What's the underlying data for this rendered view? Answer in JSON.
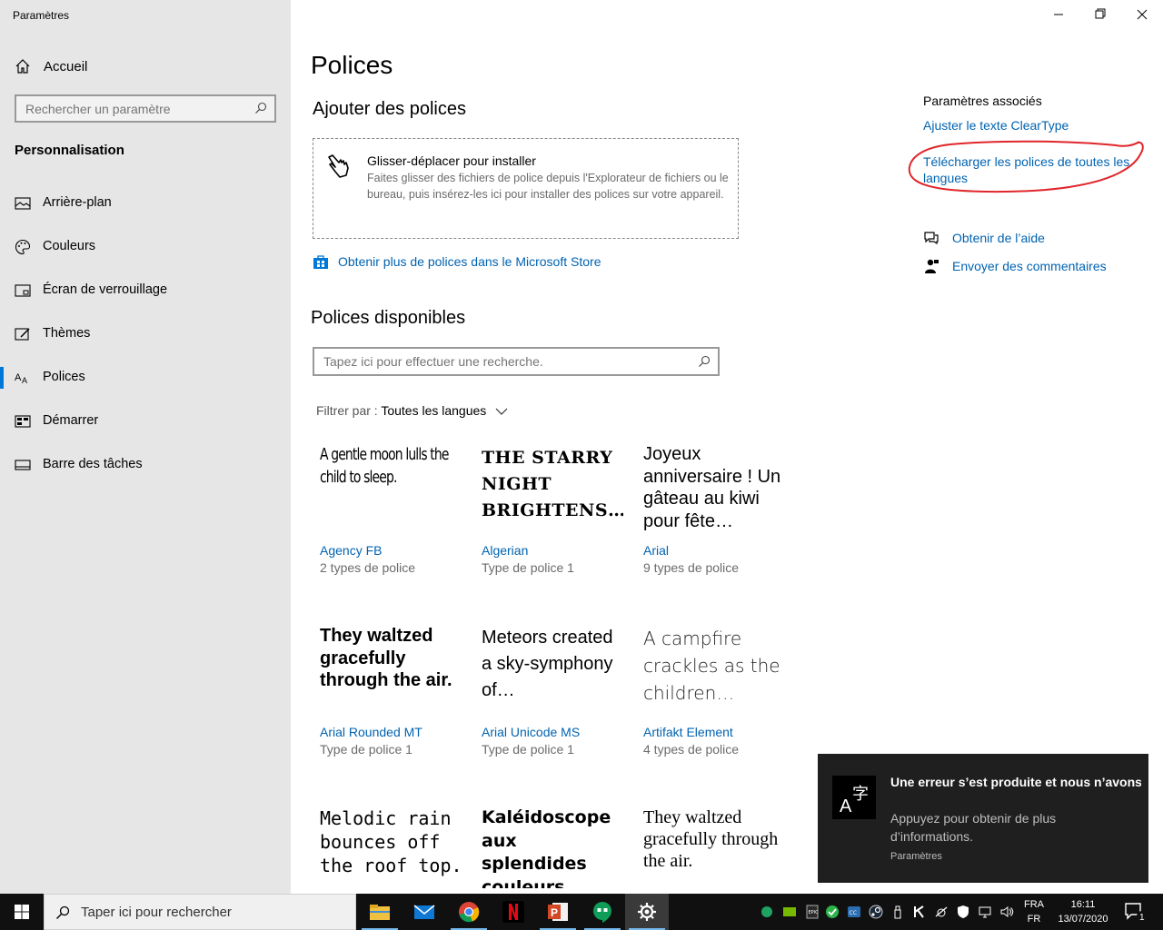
{
  "window": {
    "title": "Paramètres",
    "minimize_icon": "minimize-icon",
    "restore_icon": "restore-icon",
    "close_icon": "close-icon"
  },
  "sidebar": {
    "home_label": "Accueil",
    "search_placeholder": "Rechercher un paramètre",
    "section": "Personnalisation",
    "items": [
      {
        "label": "Arrière-plan",
        "icon": "picture-icon"
      },
      {
        "label": "Couleurs",
        "icon": "palette-icon"
      },
      {
        "label": "Écran de verrouillage",
        "icon": "lockscreen-icon"
      },
      {
        "label": "Thèmes",
        "icon": "brush-icon"
      },
      {
        "label": "Polices",
        "icon": "font-icon",
        "active": true
      },
      {
        "label": "Démarrer",
        "icon": "start-icon"
      },
      {
        "label": "Barre des tâches",
        "icon": "taskbar-icon"
      }
    ]
  },
  "main": {
    "title": "Polices",
    "add_heading": "Ajouter des polices",
    "dropzone_title": "Glisser-déplacer pour installer",
    "dropzone_desc": "Faites glisser des fichiers de police depuis l'Explorateur de fichiers ou le bureau, puis insérez-les ici pour installer des polices sur votre appareil.",
    "store_link": "Obtenir plus de polices dans le Microsoft Store",
    "available_heading": "Polices disponibles",
    "search_placeholder": "Tapez ici pour effectuer une recherche.",
    "filter_label": "Filtrer par :",
    "filter_value": "Toutes les langues"
  },
  "fonts": [
    {
      "sample": "A gentle moon lulls the child to sleep.",
      "name": "Agency FB",
      "count": "2 types de police"
    },
    {
      "sample": "THE STARRY NIGHT BRIGHTENS…",
      "name": "Algerian",
      "count": "Type de police 1"
    },
    {
      "sample": "Joyeux anniversaire ! Un gâteau au kiwi pour fête…",
      "name": "Arial",
      "count": "9 types de police"
    },
    {
      "sample": "They waltzed gracefully through the air.",
      "name": "Arial Rounded MT",
      "count": "Type de police 1"
    },
    {
      "sample": "Meteors created a sky-symphony of…",
      "name": "Arial Unicode MS",
      "count": "Type de police 1"
    },
    {
      "sample": "A campfire crackles as the children…",
      "name": "Artifakt Element",
      "count": "4 types de police"
    },
    {
      "sample": "Melodic rain bounces off the roof top.",
      "name": "",
      "count": ""
    },
    {
      "sample": "Kaléidoscope aux splendides couleurs.",
      "name": "",
      "count": ""
    },
    {
      "sample": "They waltzed gracefully through the air.",
      "name": "",
      "count": ""
    }
  ],
  "related": {
    "title": "Paramètres associés",
    "cleartype": "Ajuster le texte ClearType",
    "download": "Télécharger les polices de toutes les langues",
    "help": "Obtenir de l’aide",
    "feedback": "Envoyer des commentaires",
    "annotation_color": "#e0262b"
  },
  "toast": {
    "title": "Une erreur s’est produite et nous n’avons pas pu installer de fonctionr",
    "body": "Appuyez pour obtenir de plus d’informations.",
    "app": "Paramètres"
  },
  "taskbar": {
    "search_placeholder": "Taper ici pour rechercher",
    "apps": [
      "file-explorer-icon",
      "mail-icon",
      "chrome-icon",
      "netflix-icon",
      "powerpoint-icon",
      "hangouts-icon",
      "settings-icon"
    ],
    "lang_top": "FRA",
    "lang_bottom": "FR",
    "time": "16:11",
    "date": "13/07/2020",
    "notif_count": "1"
  },
  "colors": {
    "accent": "#0078d7",
    "link": "#0063b1",
    "sidebar_bg": "#e6e6e6"
  }
}
